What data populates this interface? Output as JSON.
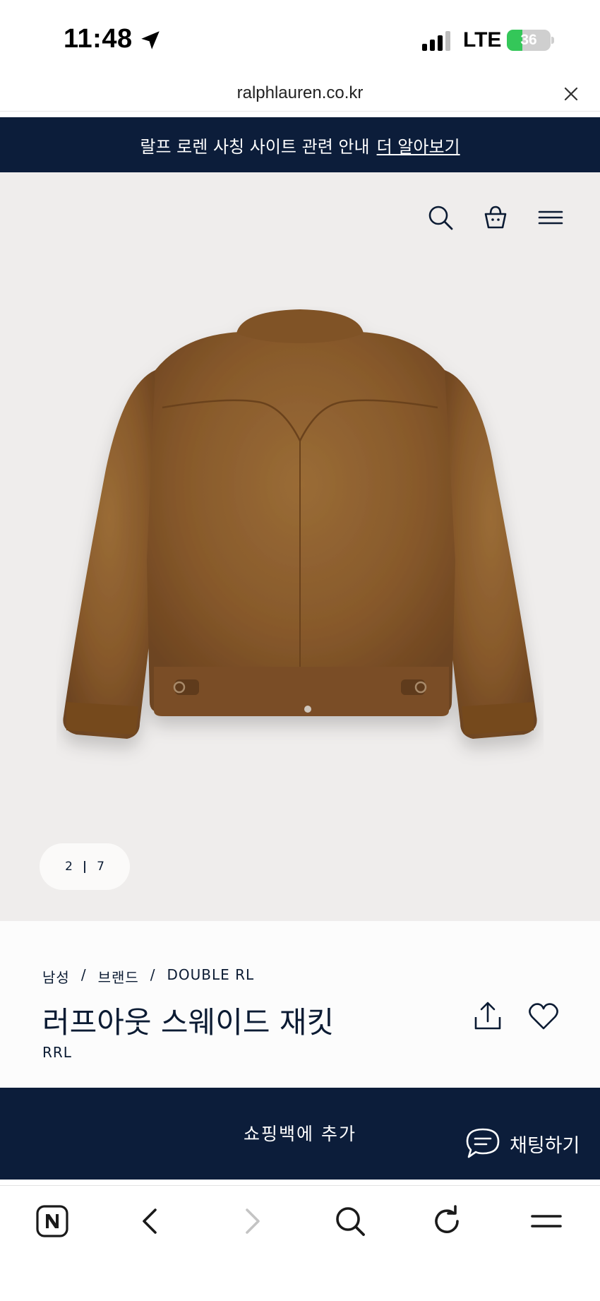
{
  "status_bar": {
    "time": "11:48",
    "carrier": "LTE",
    "battery_level": "36",
    "battery_percent": 36,
    "battery_color": "#34c759"
  },
  "browser": {
    "url": "ralphlauren.co.kr",
    "close_icon": "close-icon"
  },
  "banner": {
    "text": "랄프 로렌 사칭 사이트 관련 안내",
    "link": "더 알아보기",
    "background": "#0c1d3a"
  },
  "header_icons": [
    "search-icon",
    "shopping-bag-icon",
    "menu-icon"
  ],
  "gallery": {
    "current": "2",
    "separator": "|",
    "total": "7",
    "background": "#efedec"
  },
  "product": {
    "breadcrumb": [
      "남성",
      "브랜드",
      "DOUBLE RL"
    ],
    "breadcrumb_separator": "/",
    "title": "러프아웃 스웨이드 재킷",
    "brand": "RRL",
    "action_icons": [
      "share-icon",
      "heart-icon"
    ]
  },
  "bag_bar": {
    "add_to_bag": "쇼핑백에 추가",
    "chat": "채팅하기",
    "background": "#0c1d3a"
  },
  "bottom_toolbar": {
    "icons": [
      "naver-home-icon",
      "back-icon",
      "forward-icon",
      "search-icon",
      "reload-icon",
      "menu-icon"
    ]
  }
}
